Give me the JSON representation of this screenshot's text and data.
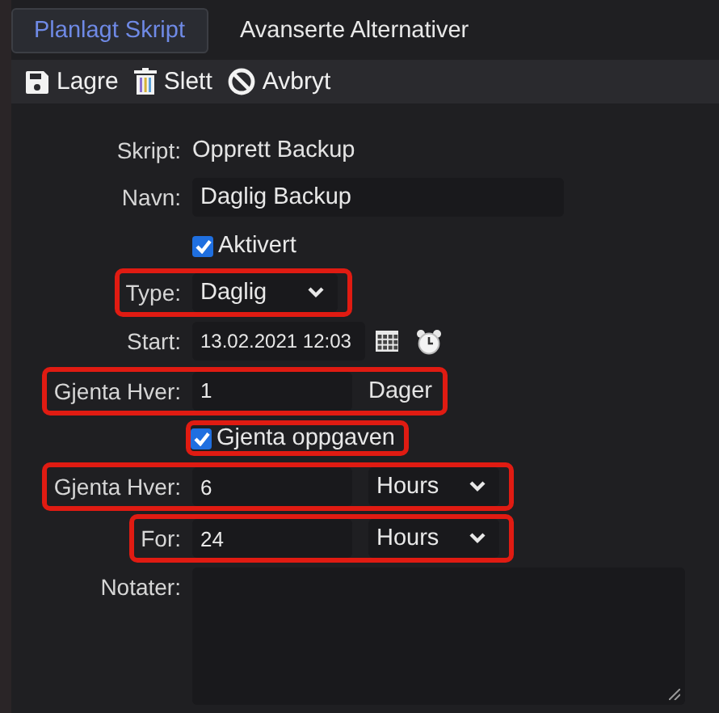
{
  "tabs": [
    {
      "label": "Planlagt Skript",
      "selected": true
    },
    {
      "label": "Avanserte Alternativer",
      "selected": false
    }
  ],
  "toolbar": [
    {
      "kind": "save",
      "label": "Lagre"
    },
    {
      "kind": "delete",
      "label": "Slett"
    },
    {
      "kind": "cancel",
      "label": "Avbryt"
    }
  ],
  "form": [
    {
      "kind": "text",
      "label": "Skript:",
      "value": "Opprett Backup",
      "highlighted": false
    },
    {
      "kind": "input",
      "label": "Navn:",
      "value": "Daglig Backup",
      "highlighted": false
    },
    {
      "kind": "checkbox",
      "text": "Aktivert",
      "checked": true,
      "highlighted": false
    },
    {
      "kind": "select",
      "label": "Type:",
      "value": "Daglig",
      "highlighted": true
    },
    {
      "kind": "datetime",
      "label": "Start:",
      "value": "13.02.2021 12:03",
      "highlighted": false
    },
    {
      "kind": "input_unit",
      "label": "Gjenta Hver:",
      "value": "1",
      "unit": "Dager",
      "highlighted": true
    },
    {
      "kind": "checkbox",
      "text": "Gjenta oppgaven",
      "checked": true,
      "highlighted": true
    },
    {
      "kind": "input_select",
      "label": "Gjenta Hver:",
      "value": "6",
      "unit": "Hours",
      "highlighted": true
    },
    {
      "kind": "input_select",
      "label": "For:",
      "value": "24",
      "unit": "Hours",
      "highlighted": true
    },
    {
      "kind": "textarea",
      "label": "Notater:",
      "highlighted": false
    }
  ]
}
